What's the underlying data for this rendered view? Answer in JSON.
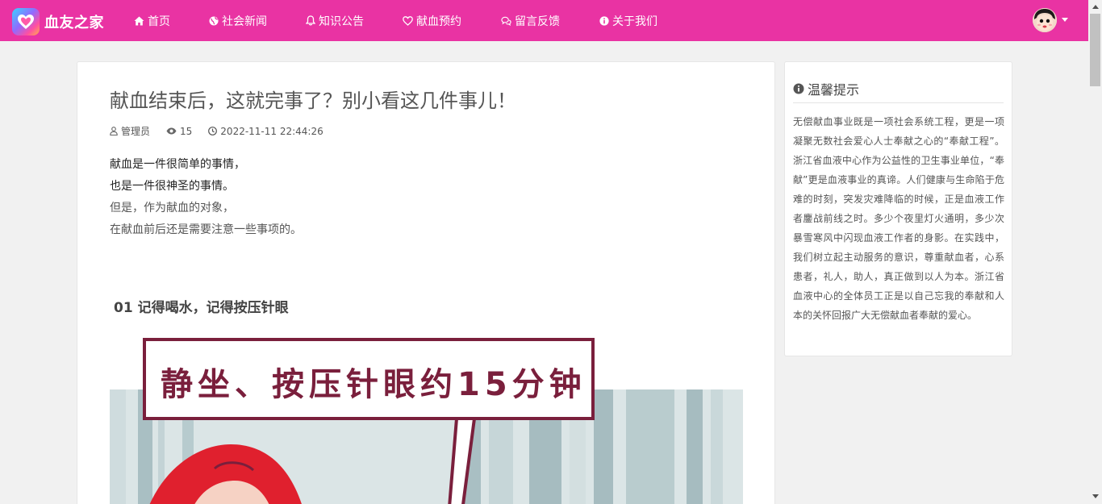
{
  "brand": {
    "name": "血友之家",
    "logo_icon": "heart-logo-icon"
  },
  "nav": {
    "items": [
      {
        "label": "首页",
        "icon": "home-icon"
      },
      {
        "label": "社会新闻",
        "icon": "globe-icon"
      },
      {
        "label": "知识公告",
        "icon": "bell-icon"
      },
      {
        "label": "献血预约",
        "icon": "heart-icon"
      },
      {
        "label": "留言反馈",
        "icon": "comments-icon"
      },
      {
        "label": "关于我们",
        "icon": "info-circle-icon"
      }
    ]
  },
  "user": {
    "avatar_icon": "user-avatar",
    "menu_icon": "caret-down-icon"
  },
  "article": {
    "title": "献血结束后，这就完事了？别小看这几件事儿！",
    "author": "管理员",
    "views": "15",
    "datetime": "2022-11-11 22:44:26",
    "paragraphs": [
      "献血是一件很简单的事情，",
      "也是一件很神圣的事情。",
      "但是，作为献血的对象，",
      "在献血前后还是需要注意一些事项的。"
    ],
    "section_heading": "01 记得喝水，记得按压针眼",
    "image_caption": "静坐、按压针眼约15分钟"
  },
  "sidebar": {
    "title": "温馨提示",
    "text": "无偿献血事业既是一项社会系统工程，更是一项凝聚无数社会爱心人士奉献之心的“奉献工程”。浙江省血液中心作为公益性的卫生事业单位，“奉献”更是血液事业的真谛。人们健康与生命陷于危难的时刻，突发灾难降临的时候，正是血液工作者鏖战前线之时。多少个夜里灯火通明，多少次暴雪寒风中闪现血液工作者的身影。在实践中，我们树立起主动服务的意识，尊重献血者，心系患者，礼人，助人，真正做到以人为本。浙江省血液中心的全体员工正是以自己忘我的奉献和人本的关怀回报广大无偿献血者奉献的爱心。"
  },
  "colors": {
    "nav_bg": "#e933a3",
    "page_bg": "#f1f1f1",
    "illustration_red": "#e0202e",
    "caption_border": "#7a1f3c"
  }
}
